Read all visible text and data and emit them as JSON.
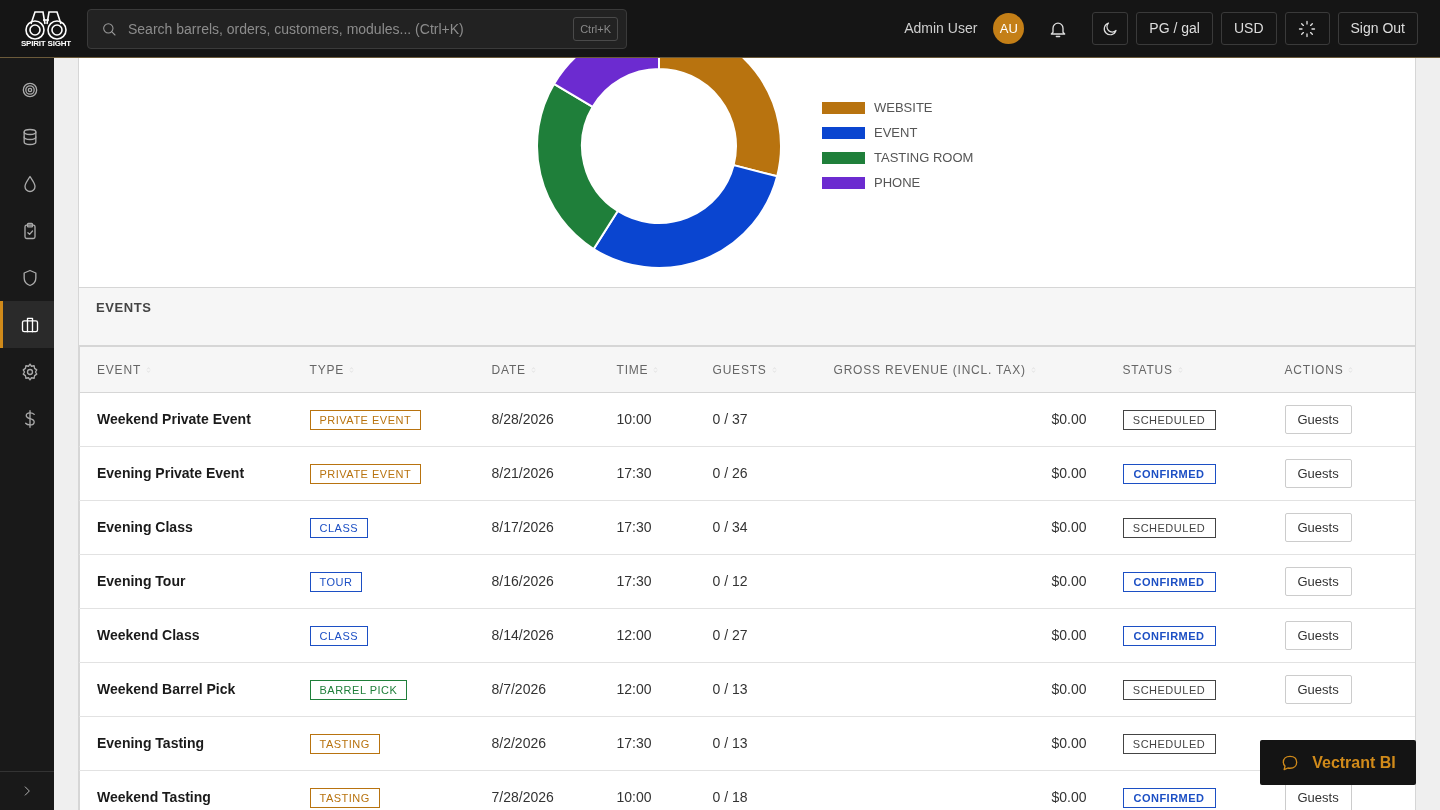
{
  "brand": {
    "name": "SPIRIT SIGHT"
  },
  "search": {
    "placeholder": "Search barrels, orders, customers, modules... (Ctrl+K)",
    "shortcut": "Ctrl+K"
  },
  "user": {
    "name": "Admin User",
    "initials": "AU"
  },
  "header_buttons": [
    {
      "kind": "bell"
    },
    {
      "kind": "moon"
    },
    {
      "kind": "text",
      "label": "PG / gal"
    },
    {
      "kind": "text",
      "label": "USD"
    },
    {
      "kind": "spinner"
    },
    {
      "kind": "text",
      "label": "Sign Out"
    }
  ],
  "sidebar": {
    "items": [
      {
        "selected": false
      },
      {
        "selected": false
      },
      {
        "selected": false
      },
      {
        "selected": false
      },
      {
        "selected": false
      },
      {
        "selected": true
      },
      {
        "selected": false
      },
      {
        "selected": false
      }
    ]
  },
  "chart_legend": [
    {
      "label": "WEBSITE",
      "color": "#b8730f"
    },
    {
      "label": "EVENT",
      "color": "#0a45d0"
    },
    {
      "label": "TASTING ROOM",
      "color": "#1f7f3a"
    },
    {
      "label": "PHONE",
      "color": "#6c2bd0"
    }
  ],
  "events": {
    "title": "EVENTS",
    "columns": [
      "EVENT",
      "TYPE",
      "DATE",
      "TIME",
      "GUESTS",
      "GROSS REVENUE (INCL. TAX)",
      "STATUS",
      "ACTIONS"
    ],
    "rows": [
      {
        "event": "Weekend Private Event",
        "type": {
          "label": "PRIVATE EVENT",
          "color": "#b8730f"
        },
        "date": "8/28/2026",
        "time": "10:00",
        "guests": "0 / 37",
        "revenue": "$0.00",
        "status": {
          "label": "SCHEDULED",
          "kind": "scheduled"
        },
        "action": "Guests"
      },
      {
        "event": "Evening Private Event",
        "type": {
          "label": "PRIVATE EVENT",
          "color": "#b8730f"
        },
        "date": "8/21/2026",
        "time": "17:30",
        "guests": "0 / 26",
        "revenue": "$0.00",
        "status": {
          "label": "CONFIRMED",
          "kind": "confirmed"
        },
        "action": "Guests"
      },
      {
        "event": "Evening Class",
        "type": {
          "label": "CLASS",
          "color": "#1c4fc4"
        },
        "date": "8/17/2026",
        "time": "17:30",
        "guests": "0 / 34",
        "revenue": "$0.00",
        "status": {
          "label": "SCHEDULED",
          "kind": "scheduled"
        },
        "action": "Guests"
      },
      {
        "event": "Evening Tour",
        "type": {
          "label": "TOUR",
          "color": "#1c4fc4"
        },
        "date": "8/16/2026",
        "time": "17:30",
        "guests": "0 / 12",
        "revenue": "$0.00",
        "status": {
          "label": "CONFIRMED",
          "kind": "confirmed"
        },
        "action": "Guests"
      },
      {
        "event": "Weekend Class",
        "type": {
          "label": "CLASS",
          "color": "#1c4fc4"
        },
        "date": "8/14/2026",
        "time": "12:00",
        "guests": "0 / 27",
        "revenue": "$0.00",
        "status": {
          "label": "CONFIRMED",
          "kind": "confirmed"
        },
        "action": "Guests"
      },
      {
        "event": "Weekend Barrel Pick",
        "type": {
          "label": "BARREL PICK",
          "color": "#1f7f3a"
        },
        "date": "8/7/2026",
        "time": "12:00",
        "guests": "0 / 13",
        "revenue": "$0.00",
        "status": {
          "label": "SCHEDULED",
          "kind": "scheduled"
        },
        "action": "Guests"
      },
      {
        "event": "Evening Tasting",
        "type": {
          "label": "TASTING",
          "color": "#b8730f"
        },
        "date": "8/2/2026",
        "time": "17:30",
        "guests": "0 / 13",
        "revenue": "$0.00",
        "status": {
          "label": "SCHEDULED",
          "kind": "scheduled"
        }
      },
      {
        "event": "Weekend Tasting",
        "type": {
          "label": "TASTING",
          "color": "#b8730f"
        },
        "date": "7/28/2026",
        "time": "10:00",
        "guests": "0 / 18",
        "revenue": "$0.00",
        "status": {
          "label": "CONFIRMED",
          "kind": "confirmed"
        },
        "action": "Guests"
      }
    ]
  },
  "assistant": {
    "label": "Vectrant BI"
  }
}
